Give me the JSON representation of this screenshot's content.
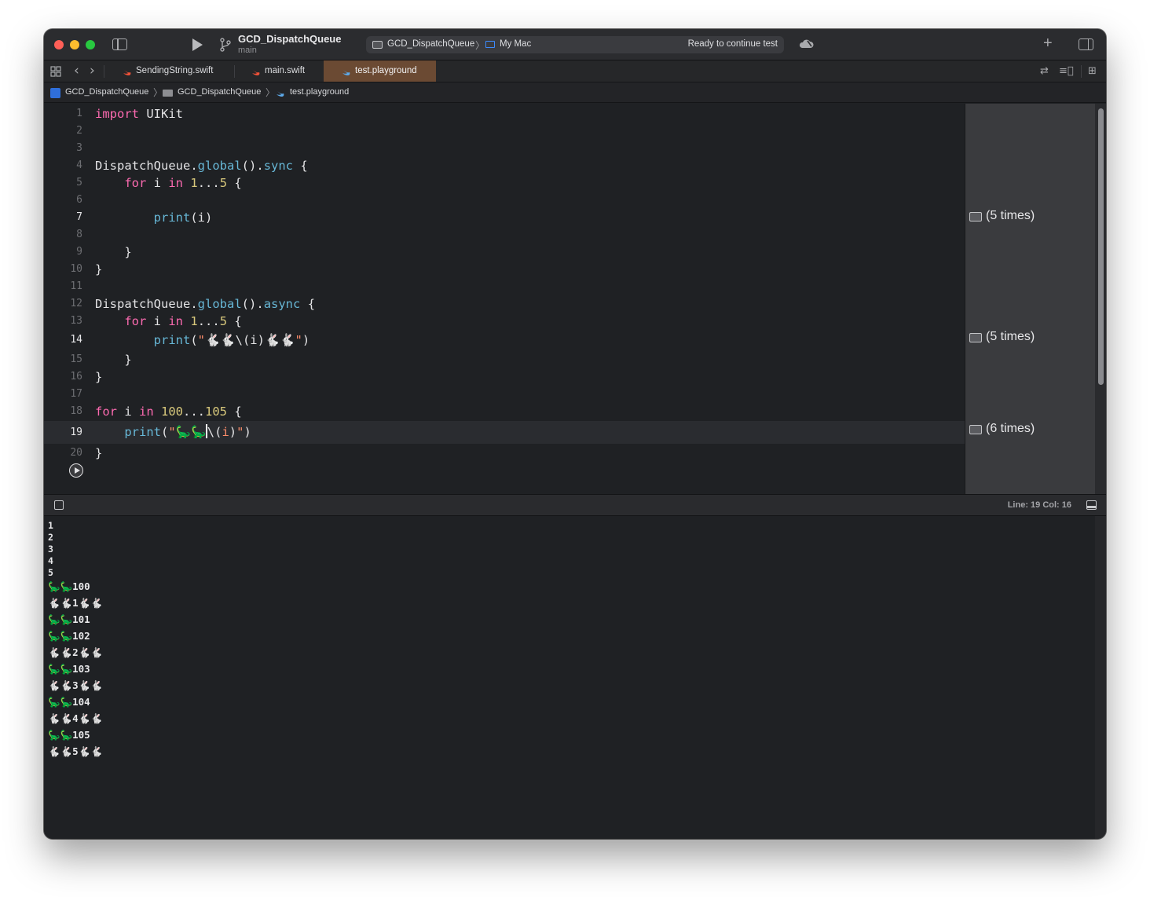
{
  "toolbar": {
    "project_title": "GCD_DispatchQueue",
    "branch": "main",
    "scheme_name": "GCD_DispatchQueue",
    "scheme_separator": "〉",
    "destination": "My Mac",
    "status": "Ready to continue test",
    "plus_label": "+"
  },
  "tabs": [
    {
      "label": "SendingString.swift",
      "active": false
    },
    {
      "label": "main.swift",
      "active": false
    },
    {
      "label": "test.playground",
      "active": true
    }
  ],
  "nav": {
    "back": "‹",
    "forward": "›"
  },
  "right_tools": {
    "swap": "⇄",
    "lines": "≡⃞",
    "split": "⊞"
  },
  "breadcrumb": {
    "items": [
      "GCD_DispatchQueue",
      "GCD_DispatchQueue",
      "test.playground"
    ],
    "separator": "〉"
  },
  "editor": {
    "current_line": 19,
    "line_numbers": [
      "1",
      "2",
      "3",
      "4",
      "5",
      "6",
      "7",
      "8",
      "9",
      "10",
      "11",
      "12",
      "13",
      "14",
      "15",
      "16",
      "17",
      "18",
      "19",
      "20"
    ],
    "code": {
      "l1": {
        "kw": "import",
        "rest": " UIKit"
      },
      "l4": {
        "type": "DispatchQueue",
        "dot": ".",
        "fn1": "global",
        "paren": "()",
        "dot2": ".",
        "fn2": "sync",
        "brace": " {"
      },
      "l5": {
        "indent": "    ",
        "kw1": "for",
        "sp1": " i ",
        "kw2": "in",
        "sp2": " ",
        "n1": "1",
        "op": "...",
        "n2": "5",
        "brace": " {"
      },
      "l7": {
        "indent": "        ",
        "fn": "print",
        "rest": "(i)"
      },
      "l9": {
        "text": "    }"
      },
      "l10": {
        "text": "}"
      },
      "l12": {
        "type": "DispatchQueue",
        "dot": ".",
        "fn1": "global",
        "paren": "()",
        "dot2": ".",
        "fn2": "async",
        "brace": " {"
      },
      "l13": {
        "indent": "    ",
        "kw1": "for",
        "sp1": " i ",
        "kw2": "in",
        "sp2": " ",
        "n1": "1",
        "op": "...",
        "n2": "5",
        "brace": " {"
      },
      "l14": {
        "indent": "        ",
        "fn": "print",
        "open": "(",
        "str1": "\"🐇🐇",
        "interp": "\\(i)",
        "str2": "🐇🐇\"",
        "close": ")"
      },
      "l15": {
        "text": "    }"
      },
      "l16": {
        "text": "}"
      },
      "l18": {
        "kw1": "for",
        "sp1": " i ",
        "kw2": "in",
        "sp2": " ",
        "n1": "100",
        "op": "...",
        "n2": "105",
        "brace": " {"
      },
      "l19": {
        "indent": "    ",
        "fn": "print",
        "open": "(",
        "str1": "\"🦕🦕",
        "interp_open": "\\(",
        "interp_var": "i",
        "interp_close": ")",
        "str2": "\"",
        "close": ")"
      },
      "l20": {
        "text": "}"
      }
    }
  },
  "results": [
    {
      "text": "(5 times)",
      "line": 7
    },
    {
      "text": "(5 times)",
      "line": 14
    },
    {
      "text": "(6 times)",
      "line": 19
    }
  ],
  "status_bar": {
    "line_col": "Line: 19  Col: 16"
  },
  "console_output": [
    "1",
    "2",
    "3",
    "4",
    "5",
    "🦕🦕100",
    "🐇🐇1🐇🐇",
    "🦕🦕101",
    "🦕🦕102",
    "🐇🐇2🐇🐇",
    "🦕🦕103",
    "🐇🐇3🐇🐇",
    "🦕🦕104",
    "🐇🐇4🐇🐇",
    "🦕🦕105",
    "🐇🐇5🐇🐇"
  ],
  "colors": {
    "keyword": "#fc6ab0",
    "function": "#67b7d6",
    "number": "#d9c97c",
    "string": "#fc8c6a",
    "active_tab": "#6b4a33"
  }
}
